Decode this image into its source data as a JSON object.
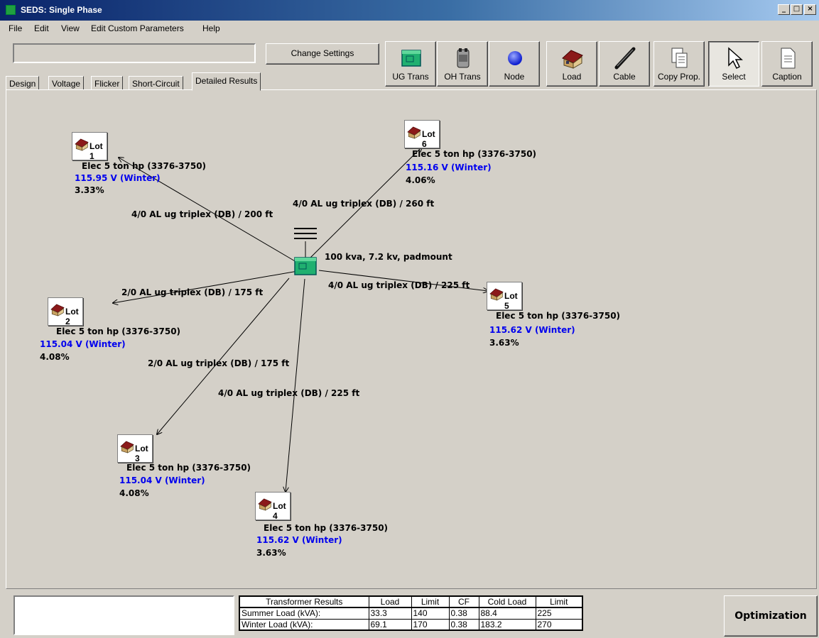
{
  "window": {
    "title": "SEDS: Single Phase",
    "min": "_",
    "max": "□",
    "close": "×"
  },
  "menu": [
    "File",
    "Edit",
    "View",
    "Edit Custom Parameters",
    "Help"
  ],
  "toolbar": {
    "change_settings": "Change Settings",
    "tools": [
      {
        "label": "UG Trans",
        "icon": "ug-transformer-icon"
      },
      {
        "label": "OH Trans",
        "icon": "oh-transformer-icon"
      },
      {
        "label": "Node",
        "icon": "node-icon"
      },
      {
        "label": "Load",
        "icon": "house-icon"
      },
      {
        "label": "Cable",
        "icon": "cable-icon"
      },
      {
        "label": "Copy Prop.",
        "icon": "copy-icon"
      },
      {
        "label": "Select",
        "icon": "pointer-icon"
      },
      {
        "label": "Caption",
        "icon": "document-icon"
      }
    ],
    "selected_tool": "Select"
  },
  "tabs": [
    "Design",
    "Voltage",
    "Flicker",
    "Short-Circuit",
    "Detailed Results"
  ],
  "active_tab": "Detailed Results",
  "colors": {
    "voltage_text": "#0000ee",
    "transformer": "#20b070",
    "roof": "#8b1a1a"
  },
  "diagram": {
    "transformer_label": "100 kva, 7.2 kv,  padmount",
    "lots": [
      {
        "name": "Lot 1",
        "load": "Elec 5 ton hp (3376-3750)",
        "voltage": "115.95 V (Winter)",
        "pct": "3.33%",
        "cable": "4/0 AL ug triplex (DB) / 200 ft"
      },
      {
        "name": "Lot 2",
        "load": "Elec 5 ton hp (3376-3750)",
        "voltage": "115.04 V (Winter)",
        "pct": "4.08%",
        "cable": "2/0 AL ug triplex (DB) / 175 ft"
      },
      {
        "name": "Lot 3",
        "load": "Elec 5 ton hp (3376-3750)",
        "voltage": "115.04 V (Winter)",
        "pct": "4.08%",
        "cable": "2/0 AL ug triplex (DB) / 175 ft"
      },
      {
        "name": "Lot 4",
        "load": "Elec 5 ton hp (3376-3750)",
        "voltage": "115.62 V (Winter)",
        "pct": "3.63%",
        "cable": "4/0 AL ug triplex (DB) / 225 ft"
      },
      {
        "name": "Lot 5",
        "load": "Elec 5 ton hp (3376-3750)",
        "voltage": "115.62 V (Winter)",
        "pct": "3.63%",
        "cable": "4/0 AL ug triplex (DB) / 225 ft"
      },
      {
        "name": "Lot 6",
        "load": "Elec 5 ton hp (3376-3750)",
        "voltage": "115.16 V (Winter)",
        "pct": "4.06%",
        "cable": "4/0 AL ug triplex (DB) / 260 ft"
      }
    ]
  },
  "results": {
    "headers": [
      "Transformer Results",
      "Load",
      "Limit",
      "CF",
      "Cold Load",
      "Limit"
    ],
    "rows": [
      [
        "Summer Load (kVA):",
        "33.3",
        "140",
        "0.38",
        "88.4",
        "225"
      ],
      [
        "Winter Load (kVA):",
        "69.1",
        "170",
        "0.38",
        "183.2",
        "270"
      ]
    ]
  },
  "optimization_button": "Optimization"
}
